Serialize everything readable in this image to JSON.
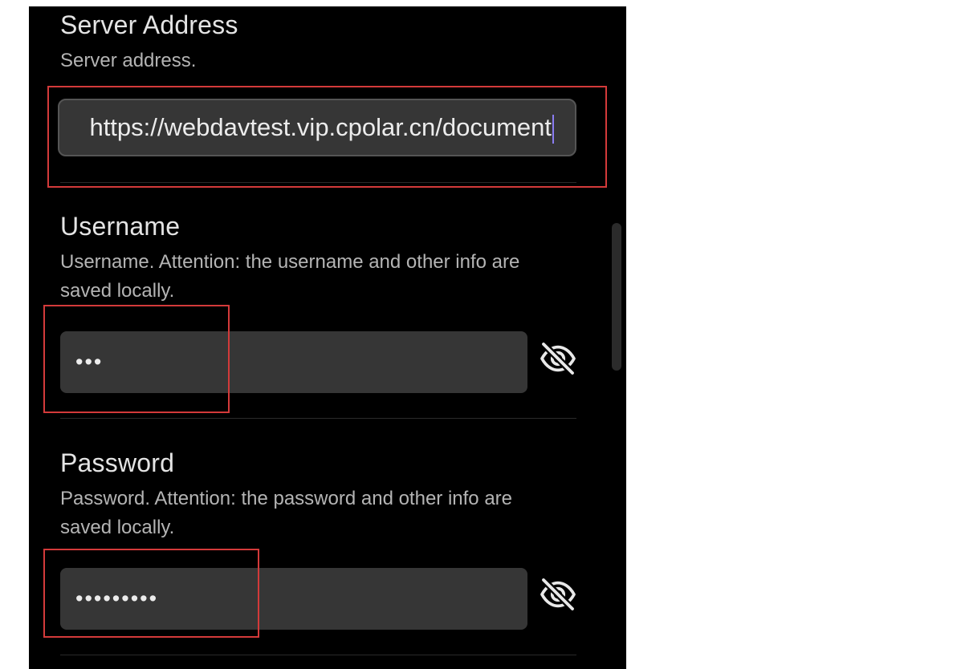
{
  "server": {
    "title": "Server Address",
    "description": "Server address.",
    "value": "https://webdavtest.vip.cpolar.cn/document"
  },
  "username": {
    "title": "Username",
    "description": "Username. Attention: the username and other info are saved locally.",
    "masked_value": "•••",
    "visibility_icon": "eye-off-icon"
  },
  "password": {
    "title": "Password",
    "description": "Password. Attention: the password and other info are saved locally.",
    "masked_value": "•••••••••",
    "visibility_icon": "eye-off-icon"
  },
  "colors": {
    "background": "#000000",
    "input_bg": "#363636",
    "text": "#e4e4e4",
    "secondary_text": "#b4b4b4",
    "caret": "#8a7cf0",
    "highlight": "#d33a3a"
  }
}
